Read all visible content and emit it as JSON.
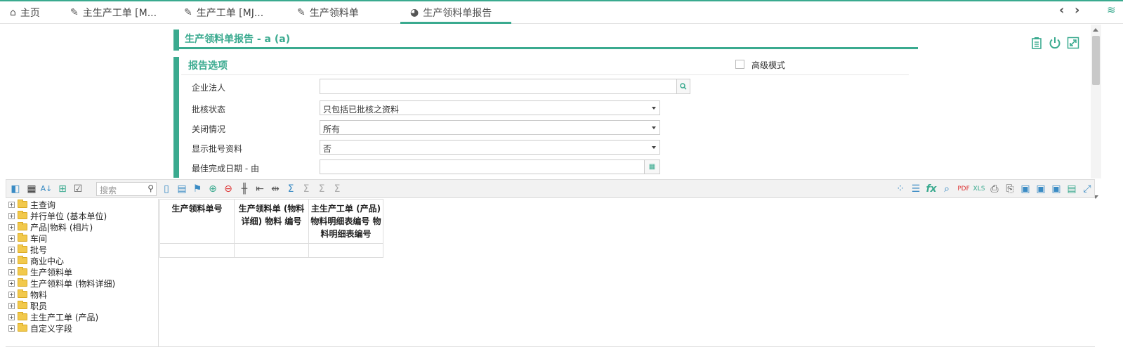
{
  "tabs": [
    {
      "label": "主页",
      "icon": "home-icon"
    },
    {
      "label": "主生产工单 [M...",
      "icon": "document-edit-icon"
    },
    {
      "label": "生产工单 [MJ...",
      "icon": "document-edit-icon"
    },
    {
      "label": "生产领料单",
      "icon": "document-edit-icon"
    },
    {
      "label": "生产领料单报告",
      "icon": "pie-chart-icon"
    }
  ],
  "report": {
    "title": "生产领料单报告 - a (a)"
  },
  "options": {
    "section_title": "报告选项",
    "advanced_mode_label": "高级模式",
    "fields": [
      {
        "label": "企业法人",
        "value": ""
      },
      {
        "label": "批核状态",
        "value": "只包括已批核之资料"
      },
      {
        "label": "关闭情况",
        "value": "所有"
      },
      {
        "label": "显示批号资料",
        "value": "否"
      },
      {
        "label": "最佳完成日期 - 由",
        "value": ""
      }
    ]
  },
  "toolbar": {
    "search_placeholder": "搜索"
  },
  "tree": {
    "items": [
      "主查询",
      "并行单位 (基本单位)",
      "产品|物料 (相片)",
      "车间",
      "批号",
      "商业中心",
      "生产领料单",
      "生产领料单 (物料详细)",
      "物料",
      "职员",
      "主生产工单 (产品)",
      "自定义字段"
    ]
  },
  "grid": {
    "columns": [
      "生产领料单号",
      "生产领料单 (物料详细) 物料 编号",
      "主生产工单 (产品) 物料明细表编号 物料明细表编号"
    ]
  },
  "colors": {
    "accent": "#3aaa8f",
    "toolbar_icon": "#3a8bc4"
  }
}
